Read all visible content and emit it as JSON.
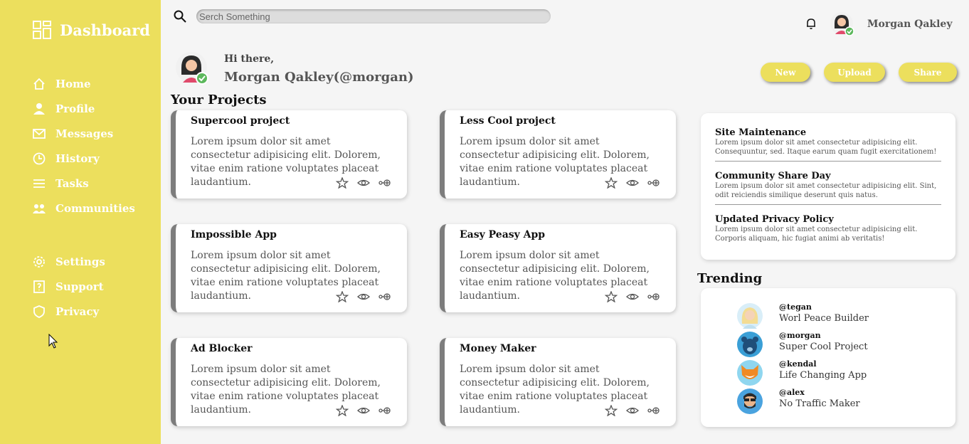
{
  "sidebar": {
    "brand": "Dashboard",
    "items": [
      {
        "label": "Home",
        "icon": "home-icon"
      },
      {
        "label": "Profile",
        "icon": "user-icon"
      },
      {
        "label": "Messages",
        "icon": "mail-icon"
      },
      {
        "label": "History",
        "icon": "clock-icon"
      },
      {
        "label": "Tasks",
        "icon": "list-icon"
      },
      {
        "label": "Communities",
        "icon": "group-icon"
      }
    ],
    "items2": [
      {
        "label": "Settings",
        "icon": "gear-icon"
      },
      {
        "label": "Support",
        "icon": "help-icon"
      },
      {
        "label": "Privacy",
        "icon": "shield-icon"
      }
    ],
    "color": "#ecdf5d"
  },
  "header": {
    "search_placeholder": "Serch Something",
    "user_name": "Morgan Qakley"
  },
  "greeting": {
    "hi": "Hi there,",
    "name": "Morgan Qakley(@morgan)"
  },
  "buttons": {
    "new": "New",
    "upload": "Upload",
    "share": "Share"
  },
  "projects": {
    "title": "Your Projects",
    "items": [
      {
        "title": "Supercool project",
        "body": "Lorem ipsum dolor sit amet consectetur adipisicing elit. Dolorem, vitae enim ratione voluptates placeat laudantium."
      },
      {
        "title": "Less Cool project",
        "body": "Lorem ipsum dolor sit amet consectetur adipisicing elit. Dolorem, vitae enim ratione voluptates placeat laudantium."
      },
      {
        "title": "Impossible App",
        "body": "Lorem ipsum dolor sit amet consectetur adipisicing elit. Dolorem, vitae enim ratione voluptates placeat laudantium."
      },
      {
        "title": "Easy Peasy App",
        "body": "Lorem ipsum dolor sit amet consectetur adipisicing elit. Dolorem, vitae enim ratione voluptates placeat laudantium."
      },
      {
        "title": "Ad Blocker",
        "body": "Lorem ipsum dolor sit amet consectetur adipisicing elit. Dolorem, vitae enim ratione voluptates placeat laudantium."
      },
      {
        "title": "Money Maker",
        "body": "Lorem ipsum dolor sit amet consectetur adipisicing elit. Dolorem, vitae enim ratione voluptates placeat laudantium."
      }
    ]
  },
  "announcements": [
    {
      "title": "Site Maintenance",
      "text": "Lorem ipsum dolor sit amet consectetur adipisicing elit. Consequuntur, sed. Itaque earum quam fugit exercitationem!"
    },
    {
      "title": "Community Share Day",
      "text": "Lorem ipsum dolor sit amet consectetur adipisicing elit. Sint, odit reiciendis similique deserunt quis natus."
    },
    {
      "title": "Updated Privacy Policy",
      "text": "Lorem ipsum dolor sit amet consectetur adipisicing elit. Corporis aliquam, hic fugiat animi ab veritatis!"
    }
  ],
  "trending": {
    "title": "Trending",
    "items": [
      {
        "handle": "@tegan",
        "project": "Worl Peace Builder",
        "avatar": "blonde-avatar"
      },
      {
        "handle": "@morgan",
        "project": "Super Cool Project",
        "avatar": "bear-avatar"
      },
      {
        "handle": "@kendal",
        "project": "Life Changing App",
        "avatar": "fox-avatar"
      },
      {
        "handle": "@alex",
        "project": "No Traffic Maker",
        "avatar": "bearded-avatar"
      }
    ]
  }
}
